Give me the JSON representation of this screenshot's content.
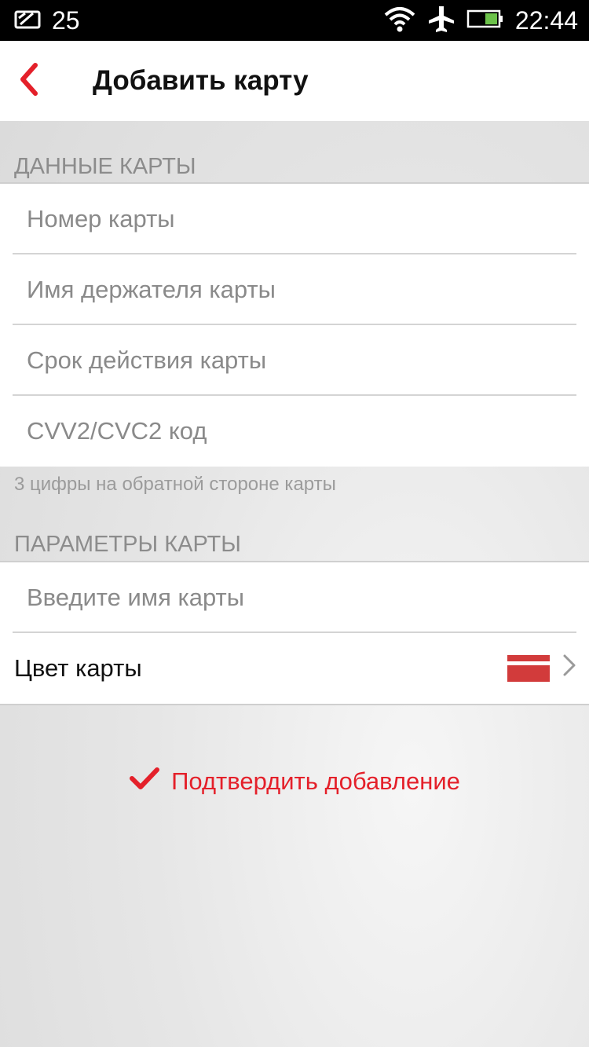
{
  "status_bar": {
    "notification_count": "25",
    "time": "22:44"
  },
  "header": {
    "title": "Добавить карту"
  },
  "card_data_section": {
    "title": "ДАННЫЕ КАРТЫ",
    "fields": [
      {
        "placeholder": "Номер карты"
      },
      {
        "placeholder": "Имя держателя карты"
      },
      {
        "placeholder": "Срок действия карты"
      },
      {
        "placeholder": "CVV2/CVC2 код"
      }
    ],
    "hint": "3 цифры на обратной стороне карты"
  },
  "card_params_section": {
    "title": "ПАРАМЕТРЫ КАРТЫ",
    "name_placeholder": "Введите имя карты",
    "color_label": "Цвет карты",
    "selected_color": "#d23b3b"
  },
  "confirm_label": "Подтвердить добавление",
  "colors": {
    "accent": "#e4202a"
  }
}
